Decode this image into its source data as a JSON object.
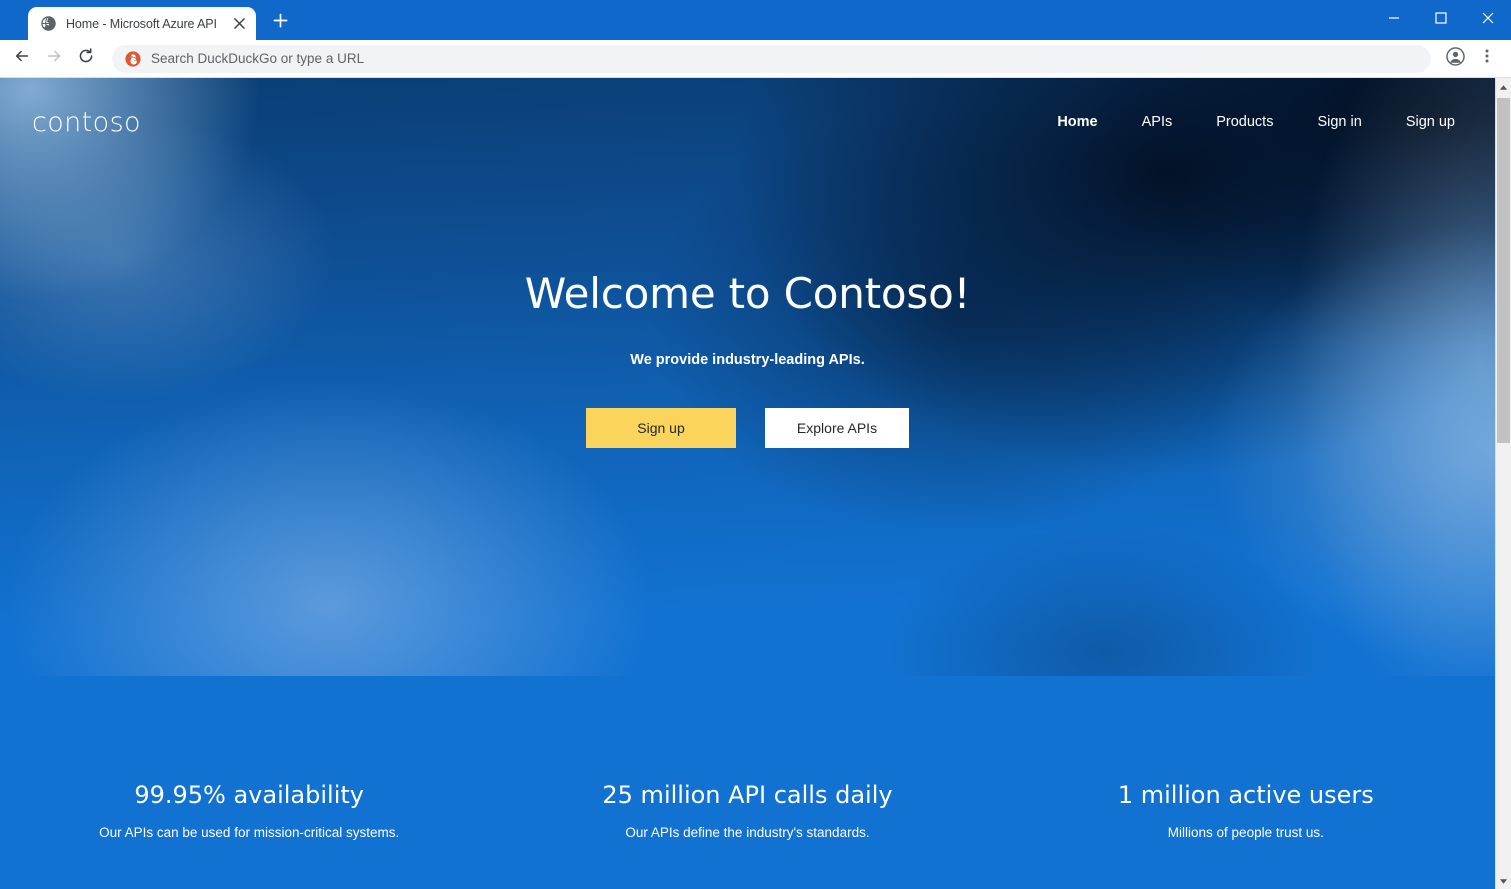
{
  "browser": {
    "tab": {
      "title": "Home - Microsoft Azure API Man",
      "favicon_icon": "globe-icon",
      "close_icon": "close-icon"
    },
    "new_tab_icon": "plus-icon",
    "window_controls": {
      "minimize_icon": "minimize-icon",
      "maximize_icon": "maximize-icon",
      "close_icon": "close-icon"
    },
    "toolbar": {
      "back_icon": "back-arrow-icon",
      "forward_icon": "forward-arrow-icon",
      "reload_icon": "reload-icon",
      "profile_icon": "profile-avatar-icon",
      "menu_icon": "three-dots-menu-icon"
    },
    "omnibox": {
      "placeholder": "Search DuckDuckGo or type a URL",
      "value": "",
      "search_engine_icon": "duckduckgo-icon"
    },
    "scrollbar": {
      "up_icon": "scroll-up-arrow-icon",
      "down_icon": "scroll-down-arrow-icon"
    }
  },
  "site": {
    "logo": "contoso",
    "nav": [
      {
        "label": "Home",
        "active": true
      },
      {
        "label": "APIs",
        "active": false
      },
      {
        "label": "Products",
        "active": false
      },
      {
        "label": "Sign in",
        "active": false
      },
      {
        "label": "Sign up",
        "active": false
      }
    ],
    "hero": {
      "title": "Welcome to Contoso!",
      "subtitle": "We provide industry-leading APIs.",
      "primary_button": "Sign up",
      "secondary_button": "Explore APIs"
    },
    "stats": [
      {
        "value": "99.95% availability",
        "desc": "Our APIs can be used for mission-critical systems."
      },
      {
        "value": "25 million API calls daily",
        "desc": "Our APIs define the industry's standards."
      },
      {
        "value": "1 million active users",
        "desc": "Millions of people trust us."
      }
    ]
  },
  "colors": {
    "brand_blue": "#1272d1",
    "hero_dark": "#0b3e74",
    "accent_yellow": "#fbd45c",
    "chrome_blue": "#1068cb",
    "text_white": "#ffffff"
  }
}
